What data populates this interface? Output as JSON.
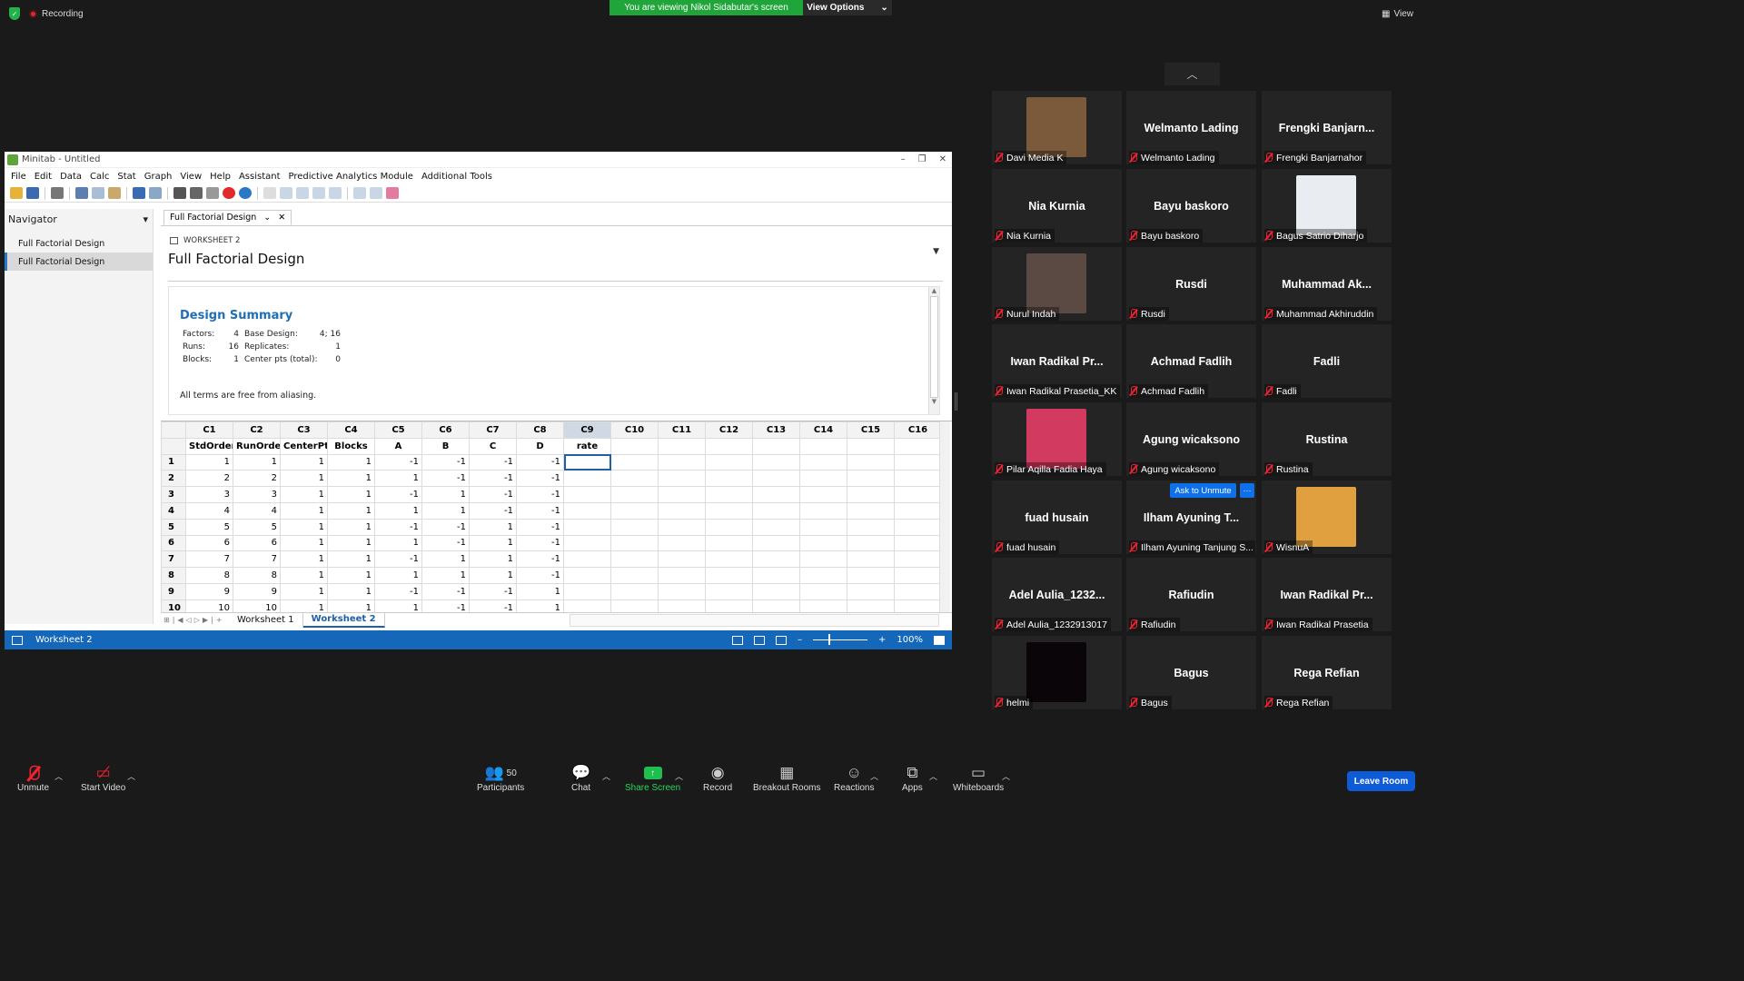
{
  "zoom_top": {
    "recording_label": "Recording",
    "viewing_banner": "You are viewing Nikol Sidabutar's screen",
    "view_options": "View Options",
    "view_label": "View"
  },
  "minitab": {
    "title": "Minitab - Untitled",
    "menu": [
      "File",
      "Edit",
      "Data",
      "Calc",
      "Stat",
      "Graph",
      "View",
      "Help",
      "Assistant",
      "Predictive Analytics Module",
      "Additional Tools"
    ],
    "navigator": {
      "title": "Navigator",
      "items": [
        "Full Factorial Design",
        "Full Factorial Design"
      ]
    },
    "doc_tab": "Full Factorial Design",
    "output": {
      "worksheet_label": "WORKSHEET 2",
      "title": "Full Factorial Design",
      "summary_title": "Design Summary",
      "rows": [
        {
          "k1": "Factors:",
          "v1": "4",
          "k2": "Base Design:",
          "v2": "4; 16"
        },
        {
          "k1": "Runs:",
          "v1": "16",
          "k2": "Replicates:",
          "v2": "1"
        },
        {
          "k1": "Blocks:",
          "v1": "1",
          "k2": "Center pts (total):",
          "v2": "0"
        }
      ],
      "note": "All terms are free from aliasing."
    },
    "grid": {
      "col_ids": [
        "C1",
        "C2",
        "C3",
        "C4",
        "C5",
        "C6",
        "C7",
        "C8",
        "C9",
        "C10",
        "C11",
        "C12",
        "C13",
        "C14",
        "C15",
        "C16"
      ],
      "col_names": [
        "StdOrder",
        "RunOrder",
        "CenterPt",
        "Blocks",
        "A",
        "B",
        "C",
        "D",
        "rate",
        "",
        "",
        "",
        "",
        "",
        "",
        ""
      ],
      "rows": [
        [
          "1",
          "1",
          "1",
          "1",
          "-1",
          "-1",
          "-1",
          "-1"
        ],
        [
          "2",
          "2",
          "1",
          "1",
          "1",
          "-1",
          "-1",
          "-1"
        ],
        [
          "3",
          "3",
          "1",
          "1",
          "-1",
          "1",
          "-1",
          "-1"
        ],
        [
          "4",
          "4",
          "1",
          "1",
          "1",
          "1",
          "-1",
          "-1"
        ],
        [
          "5",
          "5",
          "1",
          "1",
          "-1",
          "-1",
          "1",
          "-1"
        ],
        [
          "6",
          "6",
          "1",
          "1",
          "1",
          "-1",
          "1",
          "-1"
        ],
        [
          "7",
          "7",
          "1",
          "1",
          "-1",
          "1",
          "1",
          "-1"
        ],
        [
          "8",
          "8",
          "1",
          "1",
          "1",
          "1",
          "1",
          "-1"
        ],
        [
          "9",
          "9",
          "1",
          "1",
          "-1",
          "-1",
          "-1",
          "1"
        ],
        [
          "10",
          "10",
          "1",
          "1",
          "1",
          "-1",
          "-1",
          "1"
        ]
      ]
    },
    "sheet_tabs": [
      "Worksheet 1",
      "Worksheet 2"
    ],
    "status": {
      "left": "Worksheet 2",
      "zoom": "100%"
    }
  },
  "participants": [
    {
      "label": "Davi Media K",
      "big": "",
      "photo": "#7a5a3a"
    },
    {
      "label": "Welmanto Lading",
      "big": "Welmanto Lading"
    },
    {
      "label": "Frengki Banjarnahor",
      "big": "Frengki  Banjarn..."
    },
    {
      "label": "Nia Kurnia",
      "big": "Nia Kurnia"
    },
    {
      "label": "Bayu baskoro",
      "big": "Bayu baskoro"
    },
    {
      "label": "Bagus Satrio Diharjo",
      "big": "",
      "photo": "#e9edf2"
    },
    {
      "label": "Nurul Indah",
      "big": "",
      "photo": "#5b4a44"
    },
    {
      "label": "Rusdi",
      "big": "Rusdi"
    },
    {
      "label": "Muhammad Akhiruddin",
      "big": "Muhammad  Ak..."
    },
    {
      "label": "Iwan Radikal Prasetia_KK",
      "big": "Iwan  Radikal  Pr..."
    },
    {
      "label": "Achmad Fadlih",
      "big": "Achmad Fadlih"
    },
    {
      "label": "Fadli",
      "big": "Fadli"
    },
    {
      "label": "Pilar Aqilla Fadia Haya",
      "big": "",
      "photo": "#d23a5f"
    },
    {
      "label": "Agung wicaksono",
      "big": "Agung wicaksono"
    },
    {
      "label": "Rustina",
      "big": "Rustina"
    },
    {
      "label": "fuad husain",
      "big": "fuad husain"
    },
    {
      "label": "Ilham Ayuning Tanjung S...",
      "big": "Ilham Ayuning T..."
    },
    {
      "label": "WisnuA",
      "big": "",
      "photo": "#e0a040"
    },
    {
      "label": "Adel Aulia_1232913017",
      "big": "Adel  Aulia_1232..."
    },
    {
      "label": "Rafiudin",
      "big": "Rafiudin"
    },
    {
      "label": "Iwan Radikal Prasetia",
      "big": "Iwan  Radikal  Pr..."
    },
    {
      "label": "helmi",
      "big": "",
      "photo": "#0a0508"
    },
    {
      "label": "Bagus",
      "big": "Bagus"
    },
    {
      "label": "Rega Refian",
      "big": "Rega Refian"
    }
  ],
  "ask_to_unmute": "Ask to Unmute",
  "more_label": "···",
  "bottom": {
    "unmute": "Unmute",
    "start_video": "Start Video",
    "participants": "Participants",
    "participants_count": "50",
    "chat": "Chat",
    "share_screen": "Share Screen",
    "record": "Record",
    "breakout_rooms": "Breakout Rooms",
    "reactions": "Reactions",
    "apps": "Apps",
    "whiteboards": "Whiteboards",
    "leave_room": "Leave Room"
  }
}
